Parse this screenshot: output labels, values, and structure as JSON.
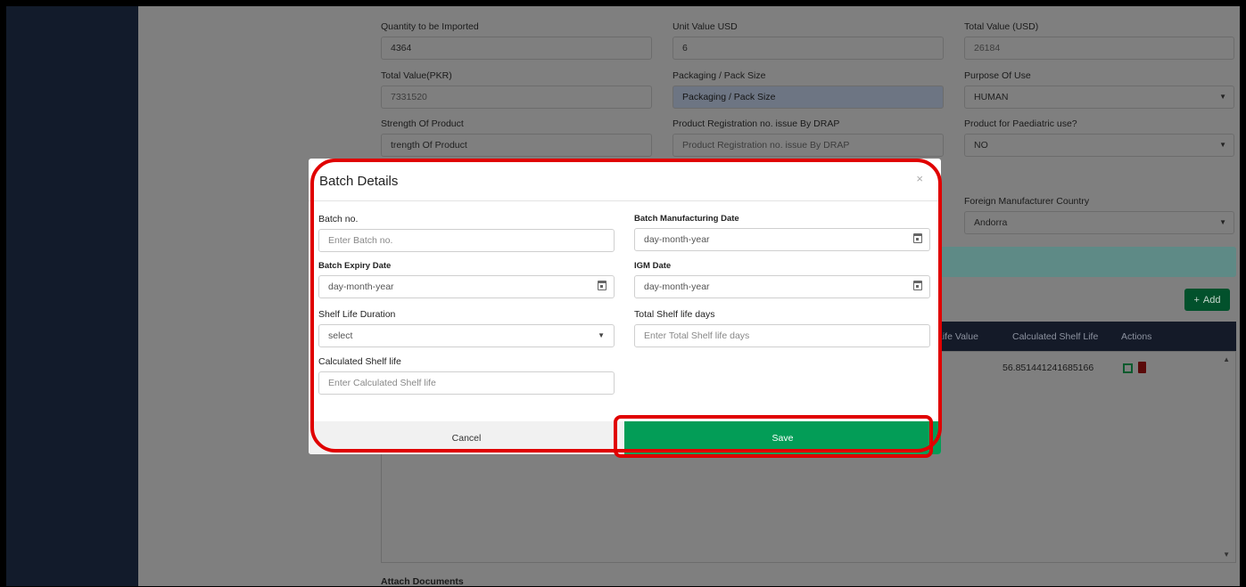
{
  "form": {
    "quantity": {
      "label": "Quantity to be Imported",
      "value": "4364"
    },
    "unit_value": {
      "label": "Unit Value USD",
      "value": "6"
    },
    "total_usd": {
      "label": "Total Value (USD)",
      "value": "26184"
    },
    "total_pkr": {
      "label": "Total Value(PKR)",
      "value": "7331520"
    },
    "packaging": {
      "label": "Packaging / Pack Size",
      "value": "Packaging / Pack Size"
    },
    "purpose": {
      "label": "Purpose Of Use",
      "value": "HUMAN"
    },
    "strength": {
      "label": "Strength Of Product",
      "value": "trength Of Product"
    },
    "reg_no": {
      "label": "Product Registration no. issue By DRAP",
      "value": "Product Registration no. issue By DRAP"
    },
    "paediatric": {
      "label": "Product for Paediatric use?",
      "value": "NO"
    },
    "country": {
      "label": "Foreign Manufacturer Country",
      "value": "Andorra"
    }
  },
  "table": {
    "add_label": "Add",
    "columns": {
      "life_value": "Life Value",
      "calculated": "Calculated Shelf Life",
      "actions": "Actions"
    },
    "row_calculated": "56.851441241685166"
  },
  "attach_label": "Attach Documents",
  "modal": {
    "title": "Batch Details",
    "close": "×",
    "batch_no": {
      "label": "Batch no.",
      "placeholder": "Enter Batch no."
    },
    "mfg_date": {
      "label": "Batch Manufacturing Date",
      "value": "day-month-year"
    },
    "expiry": {
      "label": "Batch Expiry Date",
      "value": "day-month-year"
    },
    "igm": {
      "label": "IGM Date",
      "value": "day-month-year"
    },
    "shelf_duration": {
      "label": "Shelf Life Duration",
      "value": "select"
    },
    "total_shelf": {
      "label": "Total Shelf life days",
      "placeholder": "Enter Total Shelf life days"
    },
    "calc_shelf": {
      "label": "Calculated Shelf life",
      "placeholder": "Enter Calculated Shelf life"
    },
    "cancel": "Cancel",
    "save": "Save"
  },
  "colors": {
    "save_green": "#039d57",
    "annotation_red": "#e00000",
    "sidebar_dark": "#121b2b"
  }
}
